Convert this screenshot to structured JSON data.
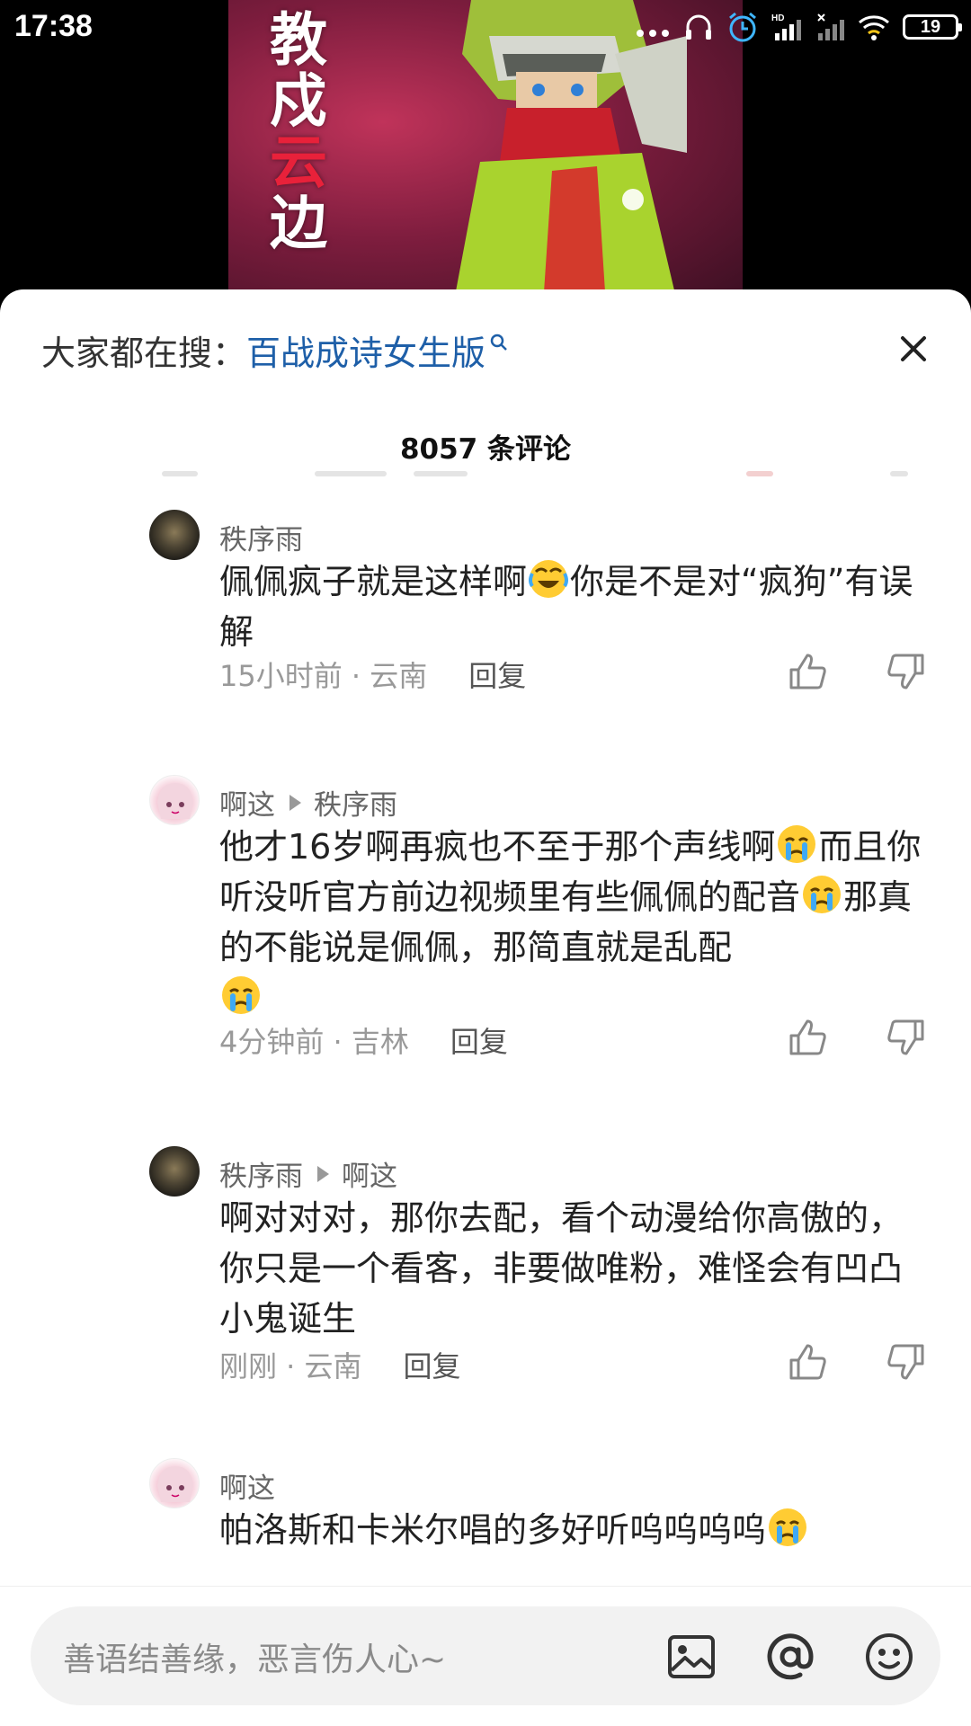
{
  "status_bar": {
    "time": "17:38",
    "battery": "19"
  },
  "video": {
    "calligraphy_top": "教戍",
    "calligraphy_red": "云",
    "calligraphy_bottom": "边"
  },
  "search_hint": {
    "prefix": "大家都在搜：",
    "query": "百战成诗女生版"
  },
  "comment_count": "8057 条评论",
  "comments": [
    {
      "user": "秩序雨",
      "reply_to": "",
      "text_parts": [
        "佩佩疯子就是这样啊",
        "你是不是对“疯狗”有误解"
      ],
      "time_location": "15小时前 · 云南",
      "reply_label": "回复"
    },
    {
      "user": "啊这",
      "reply_to": "秩序雨",
      "text_parts": [
        "他才16岁啊再疯也不至于那个声线啊",
        "而且你听没听官方前边视频里有些佩佩的配音",
        "那真的不能说是佩佩，那简直就是乱配",
        ""
      ],
      "time_location": "4分钟前 · 吉林",
      "reply_label": "回复"
    },
    {
      "user": "秩序雨",
      "reply_to": "啊这",
      "text_parts": [
        "啊对对对，那你去配，看个动漫给你高傲的，你只是一个看客，非要做唯粉，难怪会有凹凸小鬼诞生"
      ],
      "time_location": "刚刚 · 云南",
      "reply_label": "回复"
    },
    {
      "user": "啊这",
      "reply_to": "",
      "text_parts": [
        "帕洛斯和卡米尔唱的多好听呜呜呜呜",
        ""
      ],
      "time_location": "",
      "reply_label": ""
    }
  ],
  "input": {
    "placeholder": "善语结善缘，恶言伤人心~"
  },
  "colors": {
    "link": "#1e5fa8",
    "sheet_bg": "#ffffff",
    "input_bg": "#f2f2f2"
  },
  "icons": {
    "close": "close-icon",
    "search": "search-icon",
    "like": "thumbs-up-icon",
    "dislike": "thumbs-down-icon",
    "image": "image-icon",
    "mention": "at-icon",
    "emoji": "smiley-icon"
  }
}
